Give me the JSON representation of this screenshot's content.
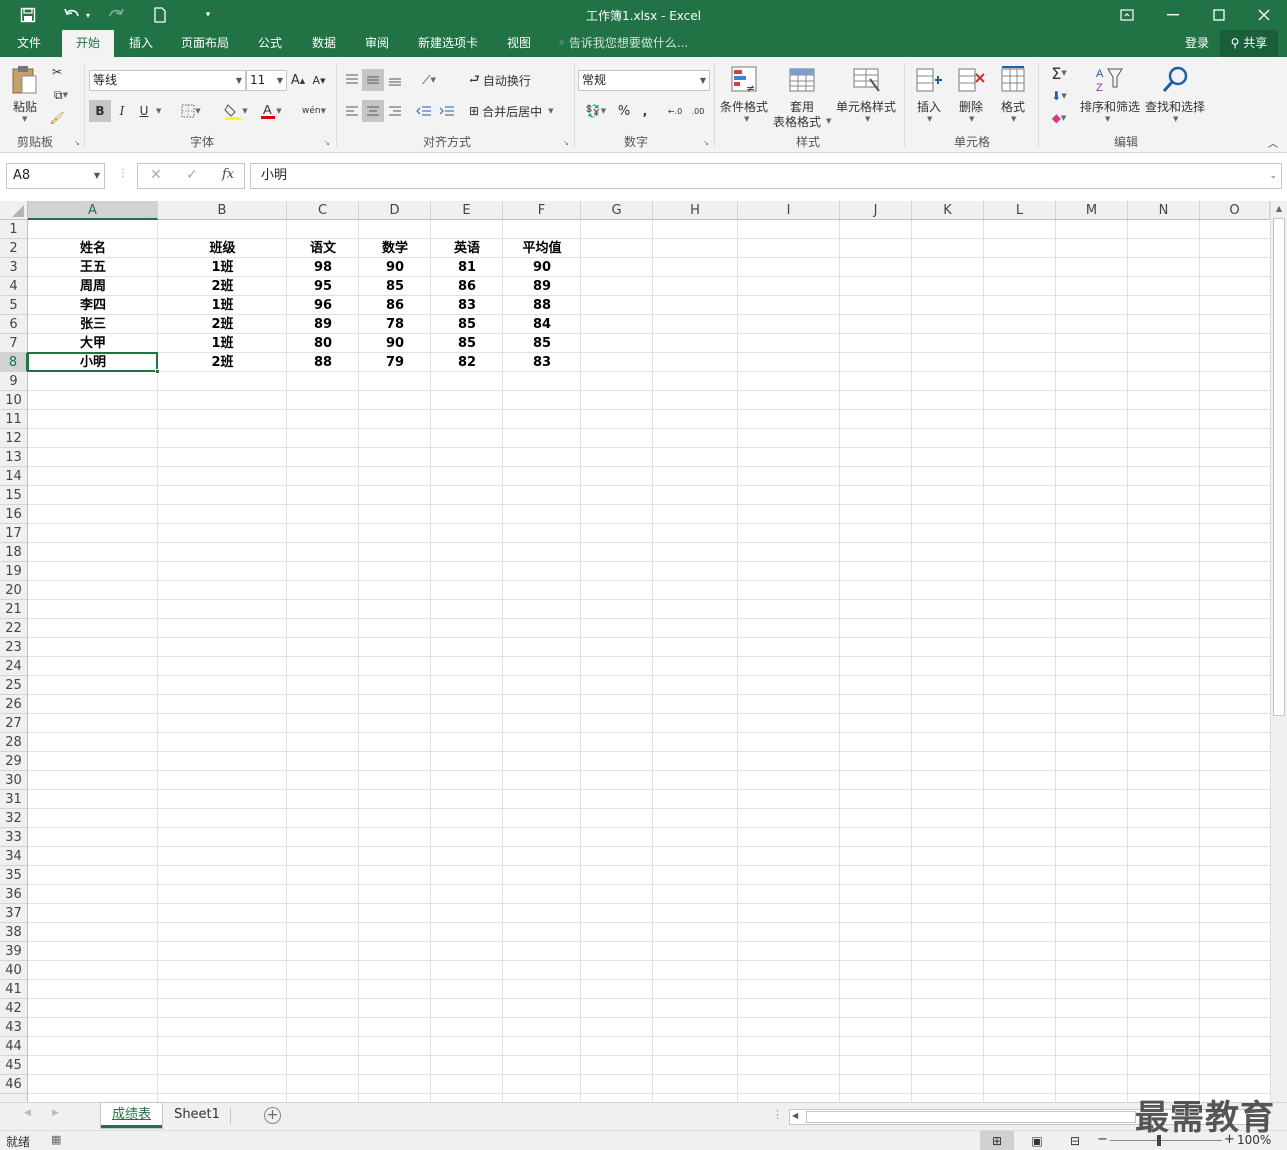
{
  "window": {
    "title": "工作簿1.xlsx - Excel",
    "accent": "#217346"
  },
  "tabs": [
    {
      "label": "文件"
    },
    {
      "label": "开始",
      "active": true
    },
    {
      "label": "插入"
    },
    {
      "label": "页面布局"
    },
    {
      "label": "公式"
    },
    {
      "label": "数据"
    },
    {
      "label": "审阅"
    },
    {
      "label": "新建选项卡"
    },
    {
      "label": "视图"
    }
  ],
  "tellme": "告诉我您想要做什么...",
  "account": {
    "login": "登录",
    "share": "共享"
  },
  "ribbon": {
    "clipboard": {
      "label": "剪贴板",
      "paste": "粘贴"
    },
    "font": {
      "label": "字体",
      "name": "等线",
      "size": "11",
      "bold": "B",
      "italic": "I",
      "underline": "U"
    },
    "alignment": {
      "label": "对齐方式",
      "wrap": "自动换行",
      "merge": "合并后居中"
    },
    "number": {
      "label": "数字",
      "format": "常规",
      "percent": "%"
    },
    "styles": {
      "label": "样式",
      "cond": "条件格式",
      "table1": "套用",
      "table2": "表格格式",
      "cellstyle": "单元格样式"
    },
    "cells": {
      "label": "单元格",
      "insert": "插入",
      "delete": "删除",
      "format": "格式"
    },
    "editing": {
      "label": "编辑",
      "sort": "排序和筛选",
      "find": "查找和选择"
    }
  },
  "formula_bar": {
    "namebox": "A8",
    "content": "小明",
    "fx": "fx"
  },
  "columns": [
    "A",
    "B",
    "C",
    "D",
    "E",
    "F",
    "G",
    "H",
    "I",
    "J",
    "K",
    "L",
    "M",
    "N",
    "O"
  ],
  "rows": [
    "1",
    "2",
    "3",
    "4",
    "5",
    "6",
    "7",
    "8",
    "9",
    "10",
    "11",
    "12",
    "13",
    "14",
    "15",
    "16",
    "17",
    "18",
    "19",
    "20",
    "21",
    "22",
    "23",
    "24",
    "25",
    "26",
    "27",
    "28",
    "29",
    "30",
    "31",
    "32",
    "33",
    "34",
    "35",
    "36",
    "37",
    "38",
    "39",
    "40",
    "41",
    "42",
    "43",
    "44",
    "45",
    "46"
  ],
  "table": {
    "headers": [
      "姓名",
      "班级",
      "语文",
      "数学",
      "英语",
      "平均值"
    ],
    "data": [
      [
        "王五",
        "1班",
        "98",
        "90",
        "81",
        "90"
      ],
      [
        "周周",
        "2班",
        "95",
        "85",
        "86",
        "89"
      ],
      [
        "李四",
        "1班",
        "96",
        "86",
        "83",
        "88"
      ],
      [
        "张三",
        "2班",
        "89",
        "78",
        "85",
        "84"
      ],
      [
        "大甲",
        "1班",
        "80",
        "90",
        "85",
        "85"
      ],
      [
        "小明",
        "2班",
        "88",
        "79",
        "82",
        "83"
      ]
    ]
  },
  "selected_cell": "A8",
  "sheets": [
    {
      "name": "成绩表",
      "active": true
    },
    {
      "name": "Sheet1",
      "active": false
    }
  ],
  "status": {
    "ready": "就绪",
    "zoom": "100%"
  },
  "watermark": "最需教育"
}
